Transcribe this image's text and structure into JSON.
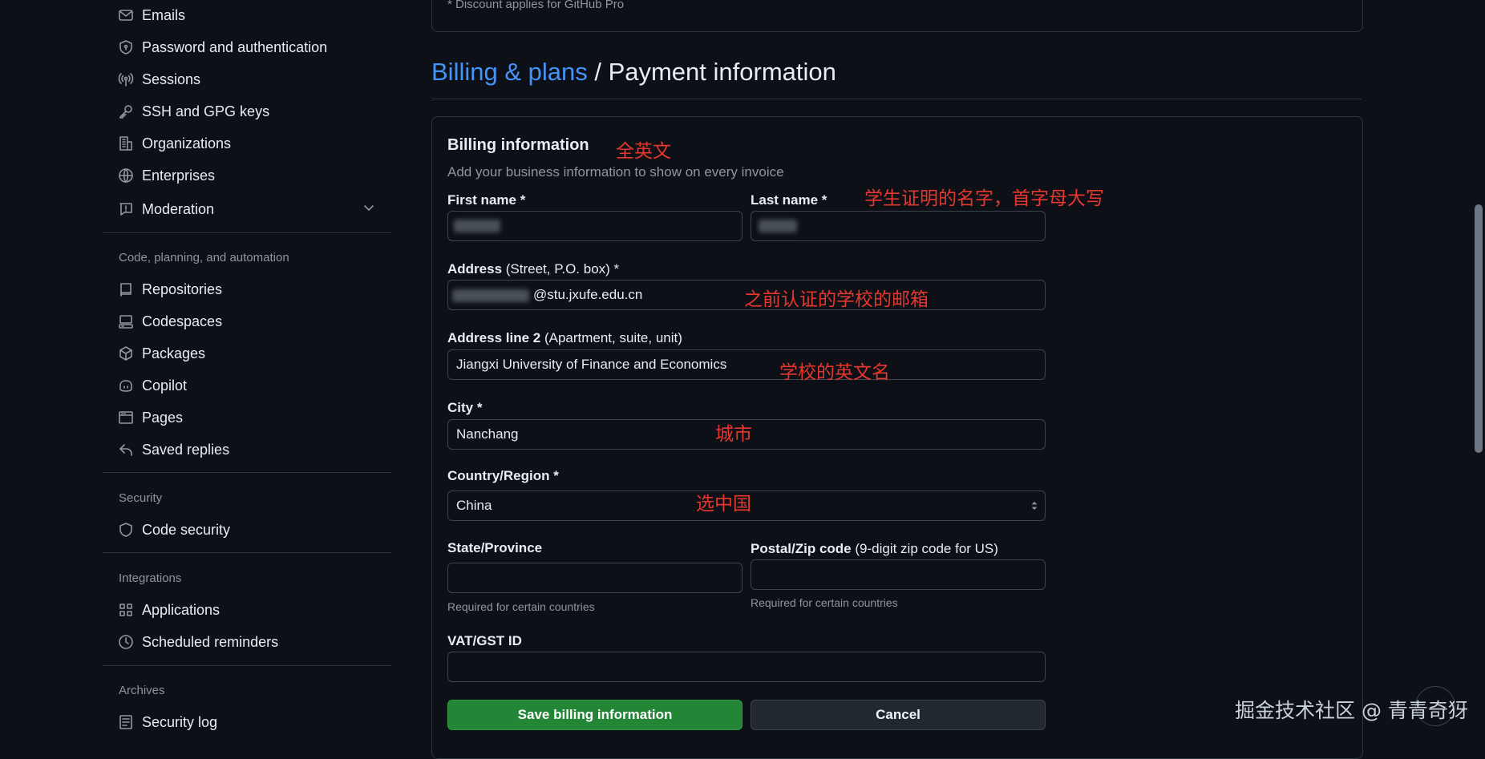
{
  "sidebar": {
    "items_top": [
      {
        "label": "Emails",
        "icon": "mail-icon"
      },
      {
        "label": "Password and authentication",
        "icon": "shield-lock-icon"
      },
      {
        "label": "Sessions",
        "icon": "broadcast-icon"
      },
      {
        "label": "SSH and GPG keys",
        "icon": "key-icon"
      },
      {
        "label": "Organizations",
        "icon": "organization-icon"
      },
      {
        "label": "Enterprises",
        "icon": "globe-icon"
      },
      {
        "label": "Moderation",
        "icon": "report-icon"
      }
    ],
    "section_code": "Code, planning, and automation",
    "items_code": [
      {
        "label": "Repositories",
        "icon": "repo-icon"
      },
      {
        "label": "Codespaces",
        "icon": "codespaces-icon"
      },
      {
        "label": "Packages",
        "icon": "package-icon"
      },
      {
        "label": "Copilot",
        "icon": "copilot-icon"
      },
      {
        "label": "Pages",
        "icon": "browser-icon"
      },
      {
        "label": "Saved replies",
        "icon": "reply-icon"
      }
    ],
    "section_security": "Security",
    "items_security": [
      {
        "label": "Code security",
        "icon": "shield-icon"
      }
    ],
    "section_integrations": "Integrations",
    "items_integrations": [
      {
        "label": "Applications",
        "icon": "apps-icon"
      },
      {
        "label": "Scheduled reminders",
        "icon": "clock-icon"
      }
    ],
    "section_archives": "Archives",
    "items_archives": [
      {
        "label": "Security log",
        "icon": "log-icon"
      }
    ]
  },
  "main": {
    "top_note": "* Discount applies for GitHub Pro",
    "breadcrumb_link": "Billing & plans",
    "breadcrumb_sep": " / ",
    "breadcrumb_current": "Payment information",
    "form": {
      "title": "Billing information",
      "subtitle": "Add your business information to show on every invoice",
      "first_name_label": "First name *",
      "last_name_label": "Last name *",
      "address_label": "Address",
      "address_hint": " (Street, P.O. box) *",
      "address_value": "@stu.jxufe.edu.cn",
      "address2_label": "Address line 2",
      "address2_hint": " (Apartment, suite, unit)",
      "address2_value": "Jiangxi University of Finance and Economics",
      "city_label": "City *",
      "city_value": "Nanchang",
      "country_label": "Country/Region *",
      "country_value": "China",
      "state_label": "State/Province",
      "state_note": "Required for certain countries",
      "postal_label": "Postal/Zip code",
      "postal_hint": " (9-digit zip code for US)",
      "postal_note": "Required for certain countries",
      "vat_label": "VAT/GST ID",
      "save_button": "Save billing information",
      "cancel_button": "Cancel"
    }
  },
  "annotations": {
    "all_english": "全英文",
    "student_name": "学生证明的名字，首字母大写",
    "school_email": "之前认证的学校的邮箱",
    "school_name": "学校的英文名",
    "city": "城市",
    "choose_china": "选中国"
  },
  "watermark": "掘金技术社区 @ 青青奇犽",
  "colors": {
    "background": "#0d1117",
    "link": "#4493f8",
    "primary_button": "#238636",
    "annotation": "#e5372d",
    "border": "#30363d"
  }
}
